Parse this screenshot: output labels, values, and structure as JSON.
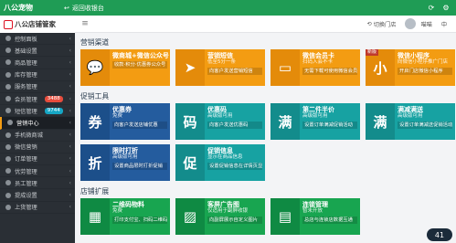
{
  "topbar": {
    "brand": "八公宠物",
    "back_label": "返回收银台",
    "icons": [
      "refresh-icon",
      "settings-icon"
    ]
  },
  "logo": {
    "text": "八公店铺管家"
  },
  "header": {
    "notice": "切换门店",
    "user": "喵喵",
    "extra": "中"
  },
  "sidebar": {
    "items": [
      {
        "label": "控制面板",
        "badge": "",
        "badge_color": ""
      },
      {
        "label": "基础设置",
        "badge": "",
        "badge_color": ""
      },
      {
        "label": "商品管理",
        "badge": "",
        "badge_color": ""
      },
      {
        "label": "库存管理",
        "badge": "",
        "badge_color": ""
      },
      {
        "label": "服务管理",
        "badge": "",
        "badge_color": ""
      },
      {
        "label": "会员管理",
        "badge": "3488",
        "badge_color": "red"
      },
      {
        "label": "短信管理",
        "badge": "9744",
        "badge_color": "teal"
      },
      {
        "label": "营销中心",
        "badge": "",
        "badge_color": "",
        "active": true
      },
      {
        "label": "手机微商城",
        "badge": "",
        "badge_color": ""
      },
      {
        "label": "微信营销",
        "badge": "",
        "badge_color": ""
      },
      {
        "label": "订单管理",
        "badge": "",
        "badge_color": ""
      },
      {
        "label": "优劳管理",
        "badge": "",
        "badge_color": ""
      },
      {
        "label": "员工管理",
        "badge": "",
        "badge_color": ""
      },
      {
        "label": "提成设置",
        "badge": "",
        "badge_color": ""
      },
      {
        "label": "上货管理",
        "badge": "",
        "badge_color": ""
      }
    ]
  },
  "sections": [
    {
      "title": "营销渠道",
      "tiles": [
        {
          "title": "微商城+微信公众号",
          "sub": "",
          "desc": "收款·积分·优惠券公众号",
          "icon": "wechat-icon",
          "glyph": "💬",
          "color": "orange",
          "ribbon": ""
        },
        {
          "title": "营销短信",
          "sub": "低至5分一条",
          "desc": "向客户发送营销短信",
          "icon": "send-icon",
          "glyph": "➤",
          "color": "orange",
          "ribbon": ""
        },
        {
          "title": "微信会员卡",
          "sub": "扫码入会不卡",
          "desc": "无需下载可使用微信会员卡",
          "icon": "card-icon",
          "glyph": "▭",
          "color": "orange",
          "ribbon": ""
        },
        {
          "title": "微信小程序",
          "sub": "向微信小程序推广门店",
          "desc": "开启门店微信小程序",
          "icon": "mini-program-icon",
          "glyph": "小",
          "color": "orange",
          "ribbon": "新版"
        }
      ]
    },
    {
      "title": "促销工具",
      "tiles": [
        {
          "title": "优惠券",
          "sub": "免费",
          "desc": "向客户发送店铺优惠",
          "icon": "coupon-icon",
          "glyph": "券",
          "color": "blue",
          "ribbon": ""
        },
        {
          "title": "优惠码",
          "sub": "高级版可用",
          "desc": "向客户发送优惠码",
          "icon": "promo-code-icon",
          "glyph": "码",
          "color": "teal",
          "ribbon": ""
        },
        {
          "title": "第二件半价",
          "sub": "高级版可用",
          "desc": "设置订单满减促销活动",
          "icon": "half-price-icon",
          "glyph": "满",
          "color": "teal",
          "ribbon": ""
        },
        {
          "title": "满减满送",
          "sub": "高级版可用",
          "desc": "设置订单满减送促销活动",
          "icon": "full-reduction-icon",
          "glyph": "满",
          "color": "teal",
          "ribbon": ""
        }
      ]
    },
    {
      "title": "",
      "tiles": [
        {
          "title": "限时打折",
          "sub": "高级版可用",
          "desc": "设置商品限时打折促销",
          "icon": "discount-icon",
          "glyph": "折",
          "color": "blue",
          "ribbon": ""
        },
        {
          "title": "促销信息",
          "sub": "显示在商品信息",
          "desc": "设置促销信息在详情页显示",
          "icon": "promo-info-icon",
          "glyph": "促",
          "color": "teal",
          "ribbon": ""
        }
      ]
    },
    {
      "title": "店铺扩展",
      "tiles": [
        {
          "title": "二维码物料",
          "sub": "免费",
          "desc": "打印支付宝、扫码二维码",
          "icon": "qrcode-icon",
          "glyph": "▦",
          "color": "green",
          "ribbon": ""
        },
        {
          "title": "客屏广告图",
          "sub": "仅适用于副屏收银",
          "desc": "向副屏展示自定义图片",
          "icon": "image-icon",
          "glyph": "▨",
          "color": "green",
          "ribbon": ""
        },
        {
          "title": "连锁管理",
          "sub": "暂未开放",
          "desc": "总店与连锁店数据互通",
          "icon": "chain-icon",
          "glyph": "▤",
          "color": "green",
          "ribbon": ""
        }
      ]
    }
  ],
  "corner_badge": "41"
}
